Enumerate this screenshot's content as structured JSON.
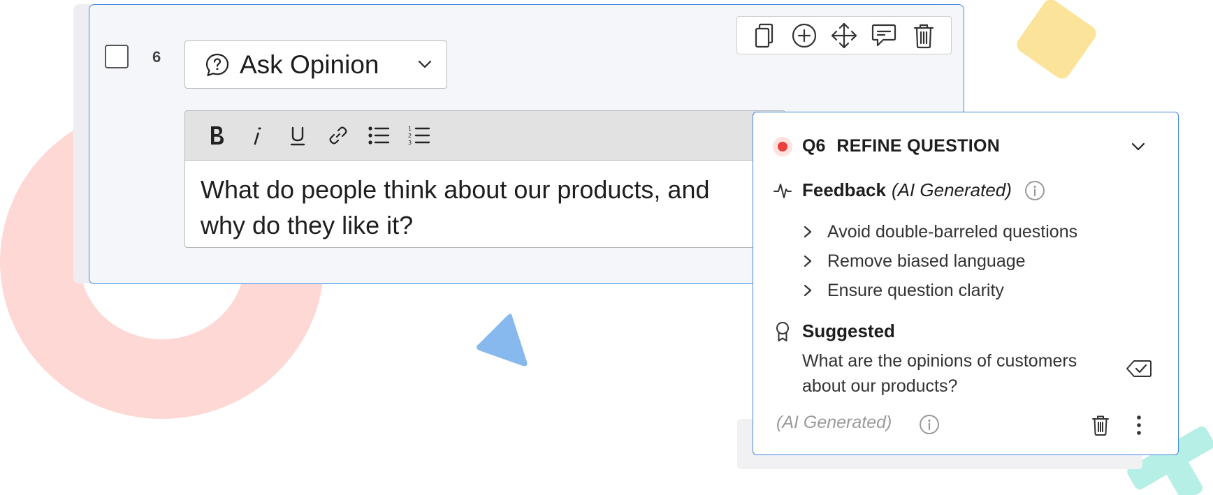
{
  "question": {
    "number": "6",
    "type_label": "Ask Opinion",
    "text": "What do people think about our products, and why do they like it?"
  },
  "toolbar": {
    "icons": [
      "duplicate-icon",
      "add-icon",
      "move-icon",
      "comment-icon",
      "delete-icon"
    ]
  },
  "editor": {
    "format_icons": [
      "bold-icon",
      "italic-icon",
      "underline-icon",
      "link-icon",
      "bullet-list-icon",
      "numbered-list-icon"
    ]
  },
  "ai_panel": {
    "qnum": "Q6",
    "title": "REFINE QUESTION",
    "feedback_label": "Feedback",
    "feedback_sub": "(AI Generated)",
    "feedback_items": [
      "Avoid double-barreled questions",
      "Remove biased language",
      "Ensure question clarity"
    ],
    "suggested_label": "Suggested",
    "suggested_text": "What are the opinions of customers about our products?",
    "footer_label": "(AI Generated)"
  },
  "colors": {
    "accent_border": "#3f86e4",
    "record_dot": "#e8423b",
    "ring_deco": "#fdd8d5",
    "yellow_deco": "#fbe49a",
    "blue_deco": "#88b9ee",
    "mint_deco": "#b5efe6"
  }
}
